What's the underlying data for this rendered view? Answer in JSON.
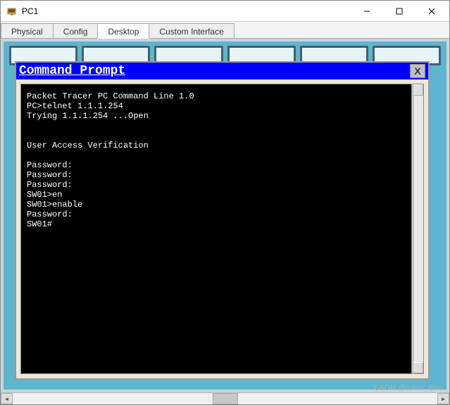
{
  "window": {
    "title": "PC1"
  },
  "tabs": {
    "physical": "Physical",
    "config": "Config",
    "desktop": "Desktop",
    "custom": "Custom Interface"
  },
  "cmdprompt": {
    "title": "Command Prompt",
    "close": "X",
    "body": "Packet Tracer PC Command Line 1.0\nPC>telnet 1.1.1.254\nTrying 1.1.1.254 ...Open\n\n\nUser Access Verification\n\nPassword: \nPassword: \nPassword: \nSW01>en\nSW01>enable\nPassword: \nSW01#"
  },
  "watermark": "CSDN @julien_qiao"
}
